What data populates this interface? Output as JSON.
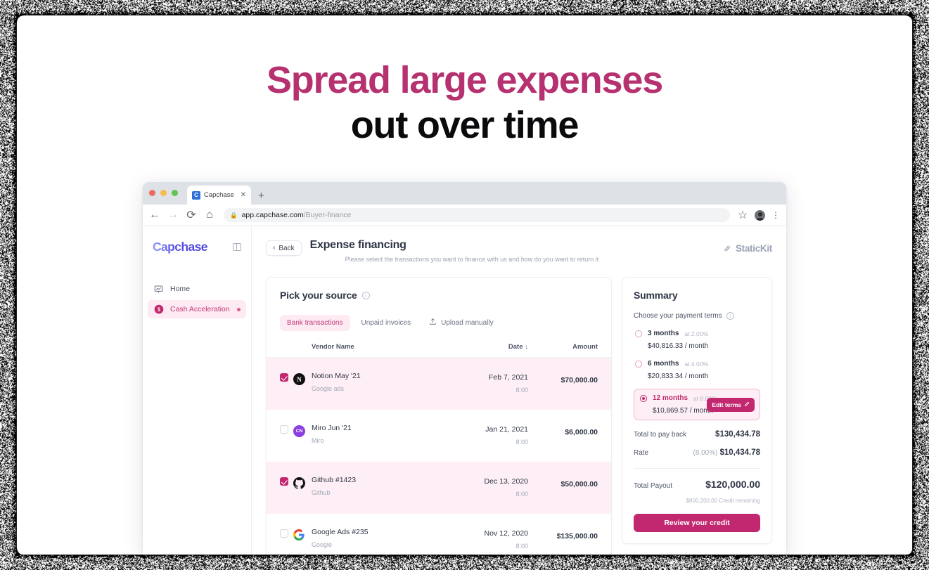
{
  "hero": {
    "line1": "Spread large expenses",
    "line2": "out over time",
    "accent_color": "#b5316f"
  },
  "browser": {
    "tab": {
      "title": "Capchase",
      "favicon_letter": "C",
      "close_label": "✕"
    },
    "new_tab_label": "+",
    "nav": {
      "back": "←",
      "forward": "→",
      "reload": "⟳",
      "home": "⌂"
    },
    "omnibox": {
      "lock_icon": "lock-icon",
      "url_domain": "app.capchase.com",
      "url_path": "/Buyer-finance"
    },
    "actions": {
      "bookmark": "☆",
      "profile": "avatar-icon",
      "menu": "⋮"
    }
  },
  "sidebar": {
    "brand": "Capchase",
    "collapse_icon": "sidebar-collapse-icon",
    "items": [
      {
        "label": "Home",
        "icon": "chart-board-icon",
        "active": false,
        "dot": false
      },
      {
        "label": "Cash Acceleration",
        "icon": "dollar-circle-icon",
        "active": true,
        "dot": true
      }
    ]
  },
  "page": {
    "back_label": "Back",
    "title": "Expense financing",
    "subtitle": "Please select the transactions you want to finance with us and how do you want to return it",
    "partner_logo": "StaticKit"
  },
  "source": {
    "title": "Pick your source",
    "info_icon": "info-icon",
    "tabs": [
      {
        "label": "Bank transactions",
        "active": true,
        "icon": null
      },
      {
        "label": "Unpaid invoices",
        "active": false,
        "icon": null
      },
      {
        "label": "Upload manually",
        "active": false,
        "icon": "upload-icon"
      }
    ],
    "columns": {
      "vendor": "Vendor Name",
      "date": "Date",
      "sort_arrow": "↓",
      "amount": "Amount"
    },
    "rows": [
      {
        "checked": true,
        "icon": "notion-icon",
        "name": "Notion May '21",
        "sub": "Google ads",
        "date": "Feb 7, 2021",
        "time": "8:00",
        "amount": "$70,000.00"
      },
      {
        "checked": false,
        "icon": "miro-icon",
        "name": "Miro Jun '21",
        "sub": "Miro",
        "date": "Jan 21, 2021",
        "time": "8:00",
        "amount": "$6,000.00"
      },
      {
        "checked": true,
        "icon": "github-icon",
        "name": "Github #1423",
        "sub": "Github",
        "date": "Dec 13, 2020",
        "time": "8:00",
        "amount": "$50,000.00"
      },
      {
        "checked": false,
        "icon": "google-icon",
        "name": "Google Ads #235",
        "sub": "Google",
        "date": "Nov 12, 2020",
        "time": "8:00",
        "amount": "$135,000.00"
      }
    ]
  },
  "summary": {
    "title": "Summary",
    "choose_label": "Choose your payment terms",
    "info_icon": "info-icon",
    "terms": [
      {
        "months": "3 months",
        "rate": "at 2.00%",
        "monthly": "$40,816.33 / month",
        "selected": false
      },
      {
        "months": "6 months",
        "rate": "at 4.00%",
        "monthly": "$20,833.34 / month",
        "selected": false
      },
      {
        "months": "12 months",
        "rate": "at 8.00%",
        "monthly": "$10,869.57 / month",
        "selected": true
      }
    ],
    "edit_terms_label": "Edit terms",
    "edit_terms_icon": "pencil-icon",
    "total_payback_label": "Total to pay back",
    "total_payback_value": "$130,434.78",
    "rate_label": "Rate",
    "rate_pct": "(8.00%)",
    "rate_value": "$10,434.78",
    "total_payout_label": "Total Payout",
    "total_payout_value": "$120,000.00",
    "credit_remaining": "$800,200.00 Credit remaining",
    "cta_label": "Review your credit",
    "accent_color": "#c2286f"
  }
}
